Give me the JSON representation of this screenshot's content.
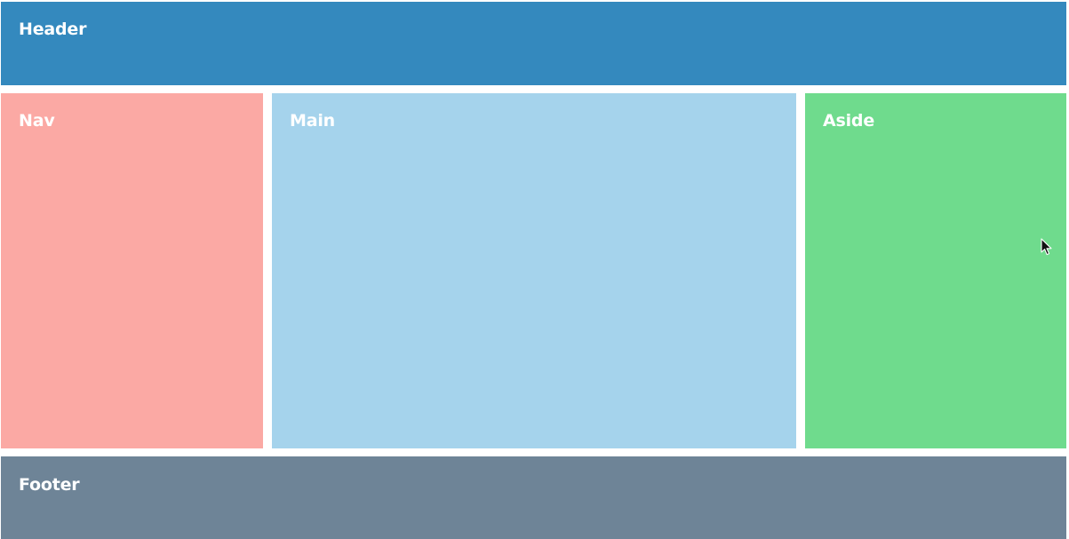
{
  "layout_regions": {
    "header": {
      "label": "Header",
      "color": "#3489be"
    },
    "nav": {
      "label": "Nav",
      "color": "#fba9a4"
    },
    "main": {
      "label": "Main",
      "color": "#a5d3ec"
    },
    "aside": {
      "label": "Aside",
      "color": "#6fdb8d"
    },
    "footer": {
      "label": "Footer",
      "color": "#6e8497"
    }
  },
  "cursor": {
    "icon": "mouse-pointer-icon"
  }
}
